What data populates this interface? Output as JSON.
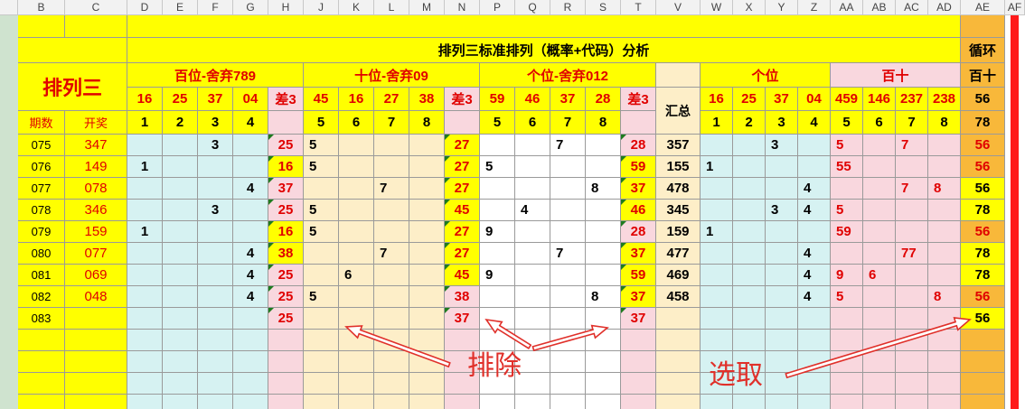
{
  "column_letters": [
    "B",
    "C",
    "D",
    "E",
    "F",
    "G",
    "H",
    "J",
    "K",
    "L",
    "M",
    "N",
    "P",
    "Q",
    "R",
    "S",
    "T",
    "V",
    "W",
    "X",
    "Y",
    "Z",
    "AA",
    "AB",
    "AC",
    "AD",
    "AE",
    "AF"
  ],
  "title": "排列三标准排列（概率+代码）分析",
  "loop_header": "循环",
  "product_name": "排列三",
  "groups": {
    "hundreds": "百位-舍弃789",
    "tens": "十位-舍弃09",
    "units": "个位-舍弃012",
    "units2": "个位",
    "hundred_ten": "百十",
    "ae_group": "百十"
  },
  "code_headers": {
    "hundreds": [
      "16",
      "25",
      "37",
      "04",
      "差3"
    ],
    "tens": [
      "45",
      "16",
      "27",
      "38",
      "差3"
    ],
    "units": [
      "59",
      "46",
      "37",
      "28",
      "差3"
    ],
    "units2": [
      "16",
      "25",
      "37",
      "04"
    ],
    "hundred_ten": [
      "459",
      "146",
      "237",
      "238"
    ],
    "ae": "56"
  },
  "index_headers": {
    "period": "期数",
    "draw": "开奖",
    "hundreds": [
      "1",
      "2",
      "3",
      "4"
    ],
    "tens": [
      "5",
      "6",
      "7",
      "8"
    ],
    "units": [
      "5",
      "6",
      "7",
      "8"
    ],
    "summary": "汇总",
    "units2": [
      "1",
      "2",
      "3",
      "4"
    ],
    "hundred_ten": [
      "5",
      "6",
      "7",
      "8"
    ],
    "ae": "78"
  },
  "rows": [
    {
      "period": "075",
      "draw": "347",
      "h": [
        "",
        "",
        "3",
        ""
      ],
      "hd": "25",
      "t": [
        "5",
        "",
        "",
        ""
      ],
      "td": "27",
      "u": [
        "",
        "",
        "7",
        ""
      ],
      "ud": "28",
      "sum": "357",
      "u2": [
        "",
        "",
        "3",
        ""
      ],
      "ht": [
        "5",
        "",
        "7",
        ""
      ],
      "ae": "56"
    },
    {
      "period": "076",
      "draw": "149",
      "h": [
        "1",
        "",
        "",
        ""
      ],
      "hd": "16",
      "t": [
        "5",
        "",
        "",
        ""
      ],
      "td": "27",
      "u": [
        "5",
        "",
        "",
        ""
      ],
      "ud": "59",
      "sum": "155",
      "u2": [
        "1",
        "",
        "",
        ""
      ],
      "ht": [
        "55",
        "",
        "",
        ""
      ],
      "ae": "56"
    },
    {
      "period": "077",
      "draw": "078",
      "h": [
        "",
        "",
        "",
        "4"
      ],
      "hd": "37",
      "t": [
        "",
        "",
        "7",
        ""
      ],
      "td": "27",
      "u": [
        "",
        "",
        "",
        "8"
      ],
      "ud": "37",
      "sum": "478",
      "u2": [
        "",
        "",
        "",
        "4"
      ],
      "ht": [
        "",
        "",
        "7",
        "8"
      ],
      "ae": "56"
    },
    {
      "period": "078",
      "draw": "346",
      "h": [
        "",
        "",
        "3",
        ""
      ],
      "hd": "25",
      "t": [
        "5",
        "",
        "",
        ""
      ],
      "td": "45",
      "u": [
        "",
        "4",
        "",
        ""
      ],
      "ud": "46",
      "sum": "345",
      "u2": [
        "",
        "",
        "3",
        "4"
      ],
      "ht": [
        "5",
        "",
        "",
        ""
      ],
      "ae": "78"
    },
    {
      "period": "079",
      "draw": "159",
      "h": [
        "1",
        "",
        "",
        ""
      ],
      "hd": "16",
      "t": [
        "5",
        "",
        "",
        ""
      ],
      "td": "27",
      "u": [
        "9",
        "",
        "",
        ""
      ],
      "ud": "28",
      "sum": "159",
      "u2": [
        "1",
        "",
        "",
        ""
      ],
      "ht": [
        "59",
        "",
        "",
        ""
      ],
      "ae": "56"
    },
    {
      "period": "080",
      "draw": "077",
      "h": [
        "",
        "",
        "",
        "4"
      ],
      "hd": "38",
      "t": [
        "",
        "",
        "7",
        ""
      ],
      "td": "27",
      "u": [
        "",
        "",
        "7",
        ""
      ],
      "ud": "37",
      "sum": "477",
      "u2": [
        "",
        "",
        "",
        "4"
      ],
      "ht": [
        "",
        "",
        "77",
        ""
      ],
      "ae": "78"
    },
    {
      "period": "081",
      "draw": "069",
      "h": [
        "",
        "",
        "",
        "4"
      ],
      "hd": "25",
      "t": [
        "",
        "6",
        "",
        ""
      ],
      "td": "45",
      "u": [
        "9",
        "",
        "",
        ""
      ],
      "ud": "59",
      "sum": "469",
      "u2": [
        "",
        "",
        "",
        "4"
      ],
      "ht": [
        "9",
        "6",
        "",
        ""
      ],
      "ae": "78"
    },
    {
      "period": "082",
      "draw": "048",
      "h": [
        "",
        "",
        "",
        "4"
      ],
      "hd": "25",
      "t": [
        "5",
        "",
        "",
        ""
      ],
      "td": "38",
      "u": [
        "",
        "",
        "",
        "8"
      ],
      "ud": "37",
      "sum": "458",
      "u2": [
        "",
        "",
        "",
        "4"
      ],
      "ht": [
        "5",
        "",
        "",
        "8"
      ],
      "ae": "56"
    },
    {
      "period": "083",
      "draw": "",
      "h": [
        "",
        "",
        "",
        ""
      ],
      "hd": "25",
      "t": [
        "",
        "",
        "",
        ""
      ],
      "td": "37",
      "u": [
        "",
        "",
        "",
        ""
      ],
      "ud": "37",
      "sum": "",
      "u2": [
        "",
        "",
        "",
        ""
      ],
      "ht": [
        "",
        "",
        "",
        ""
      ],
      "ae": "56"
    }
  ],
  "annotations": {
    "exclude": "排除",
    "select": "选取"
  },
  "colors": {
    "yellow": "#ffff00",
    "cyan": "#d6f2f2",
    "peach": "#fdeec8",
    "pink": "#f9d7de",
    "orange": "#f8b83a",
    "red_text": "#e00000",
    "annotation": "#e0302a"
  }
}
